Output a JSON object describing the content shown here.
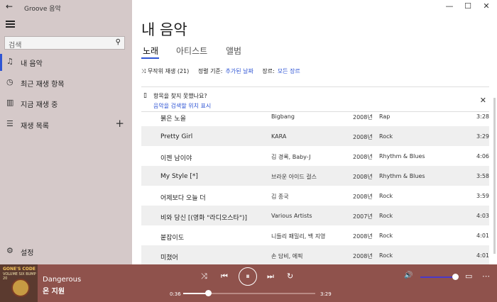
{
  "window": {
    "title": "Groove 음악",
    "back": "←",
    "minimize": "—",
    "maximize": "☐",
    "close": "✕"
  },
  "sidebar": {
    "search_placeholder": "검색",
    "items": [
      {
        "label": "내 음악",
        "icon": "♫"
      },
      {
        "label": "최근 재생 항목",
        "icon": "◷"
      },
      {
        "label": "지금 재생 중",
        "icon": "▥"
      },
      {
        "label": "재생 목록",
        "icon": "☰",
        "plus": "+"
      }
    ],
    "settings": {
      "label": "설정",
      "icon": "⚙"
    }
  },
  "main": {
    "title": "내 음악",
    "tabs": [
      "노래",
      "아티스트",
      "앨범"
    ],
    "controls": {
      "shuffle": "⤨ 무작위 재생 (21)",
      "sort_label": "정렬 기준:",
      "sort_value": "추가된 날짜",
      "genre_label": "장르:",
      "genre_value": "모든 장르"
    },
    "notice": {
      "icon": "▯",
      "title": "항목을 찾지 못했나요?",
      "link": "음악을 검색할 위치 표시",
      "close": "✕"
    },
    "songs": [
      {
        "title": "붉은 노을",
        "artist": "Bigbang",
        "year": "2008년",
        "genre": "Rap",
        "duration": "3:28"
      },
      {
        "title": "Pretty Girl",
        "artist": "KARA",
        "year": "2008년",
        "genre": "Rock",
        "duration": "3:29"
      },
      {
        "title": "이젠 남이야",
        "artist": "김 경록, Baby-J",
        "year": "2008년",
        "genre": "Rhythm & Blues",
        "duration": "4:06"
      },
      {
        "title": "My Style [*]",
        "artist": "브라운 아이드 걸스",
        "year": "2008년",
        "genre": "Rhythm & Blues",
        "duration": "3:58"
      },
      {
        "title": "어제보다 오늘 더",
        "artist": "김 종국",
        "year": "2008년",
        "genre": "Rock",
        "duration": "3:59"
      },
      {
        "title": "비와 당신 [(영화 \"라디오스타\")]",
        "artist": "Various Artists",
        "year": "2007년",
        "genre": "Rock",
        "duration": "4:03"
      },
      {
        "title": "붙잡이도",
        "artist": "니들리 패밀리, 백 지영",
        "year": "2008년",
        "genre": "Rock",
        "duration": "4:01"
      },
      {
        "title": "미쳤어",
        "artist": "손 담비, 에픽",
        "year": "2008년",
        "genre": "Rock",
        "duration": "4:01"
      }
    ]
  },
  "player": {
    "album_art_text": "GONE'S CODE",
    "album_art_sub": "VOLUME SIX BUMP 20",
    "song": "Dangerous",
    "artist": "온 지원",
    "elapsed": "0:36",
    "total": "3:29",
    "progress": 0.19,
    "volume": 0.95,
    "icons": {
      "shuffle": "⤨",
      "prev": "⏮",
      "play_pause": "⏸",
      "next": "⏭",
      "repeat": "↻",
      "volume": "🔊",
      "miniview": "▭",
      "more": "⋯"
    }
  },
  "colors": {
    "accent": "#2f55d4",
    "sidebar": "#d5c9c9",
    "player": "#8f524c"
  }
}
